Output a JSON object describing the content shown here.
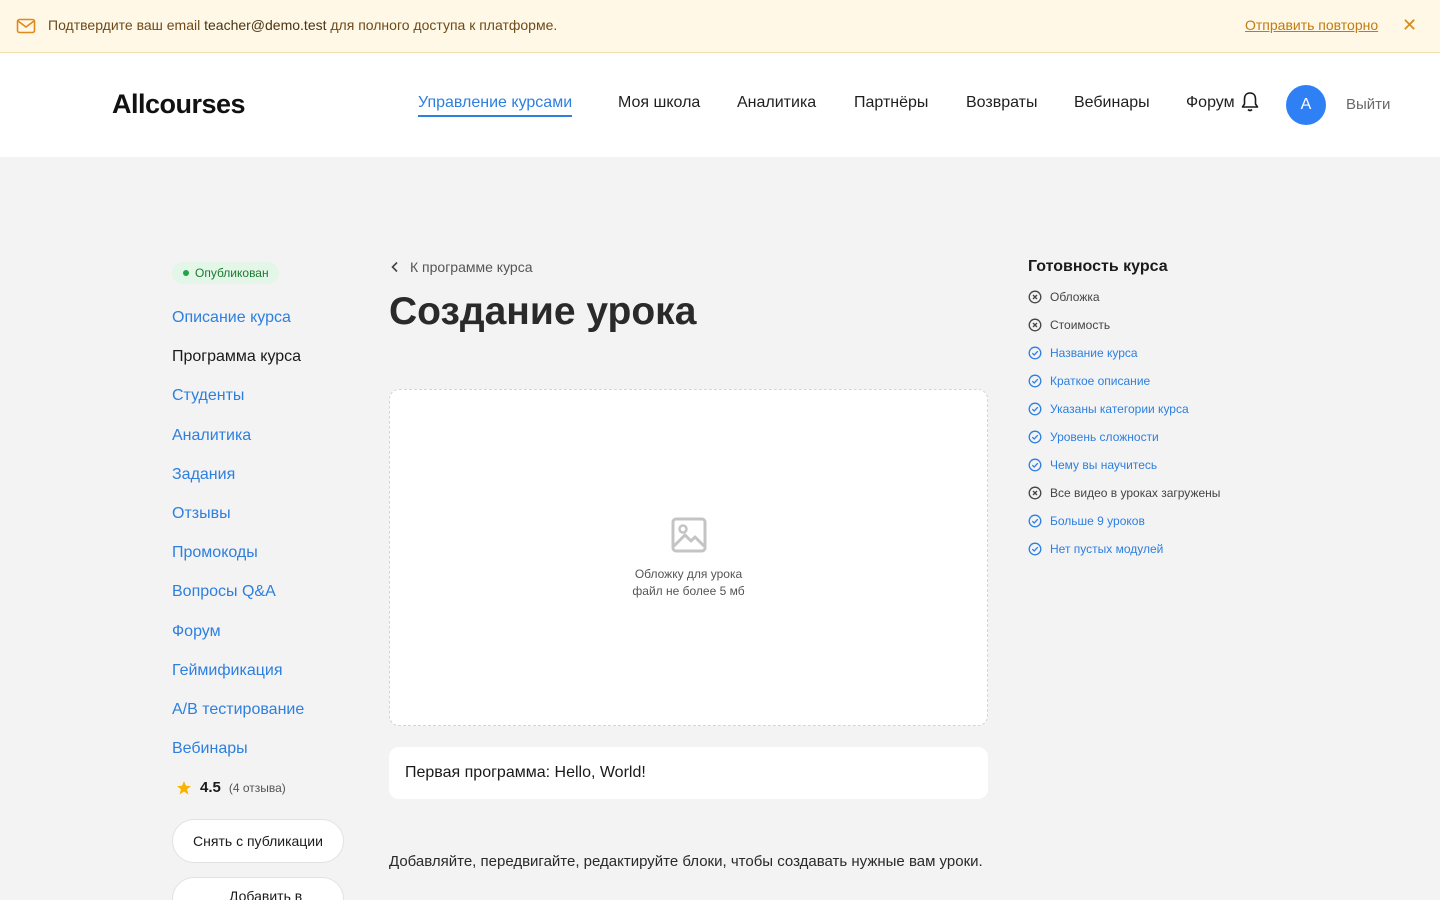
{
  "banner": {
    "prefix": "Подтвердите ваш email",
    "email": "teacher@demo.test",
    "suffix": "для полного доступа к платформе.",
    "resend_label": "Отправить повторно",
    "close_symbol": "✕"
  },
  "header": {
    "logo": "Allcourses",
    "nav": [
      {
        "label": "Управление курсами",
        "active": true
      },
      {
        "label": "Моя школа"
      },
      {
        "label": "Аналитика"
      },
      {
        "label": "Партнёры"
      },
      {
        "label": "Возвраты"
      },
      {
        "label": "Вебинары"
      },
      {
        "label": "Форум"
      }
    ],
    "avatar_letter": "A",
    "logout_label": "Выйти"
  },
  "sidebar": {
    "status_badge": "Опубликован",
    "items": [
      {
        "label": "Описание курса"
      },
      {
        "label": "Программа курса",
        "current": true
      },
      {
        "label": "Студенты"
      },
      {
        "label": "Аналитика"
      },
      {
        "label": "Задания"
      },
      {
        "label": "Отзывы"
      },
      {
        "label": "Промокоды"
      },
      {
        "label": "Вопросы Q&A"
      },
      {
        "label": "Форум"
      },
      {
        "label": "Геймификация"
      },
      {
        "label": "A/B тестирование"
      },
      {
        "label": "Вебинары"
      }
    ],
    "rating": {
      "value": "4.5",
      "count": "(4 отзыва)"
    },
    "unpublish_label": "Снять с публикации",
    "add_label": "Добавить в"
  },
  "main": {
    "back_label": "К программе курса",
    "title": "Создание урока",
    "upload": {
      "line1": "Обложку для урока",
      "line2": "файл не более 5 мб"
    },
    "lesson_name": "Первая программа: Hello, World!",
    "hint": "Добавляйте, передвигайте, редактируйте блоки, чтобы создавать нужные вам уроки."
  },
  "readiness": {
    "title": "Готовность курса",
    "items": [
      {
        "label": "Обложка",
        "done": false
      },
      {
        "label": "Стоимость",
        "done": false
      },
      {
        "label": "Название курса",
        "done": true
      },
      {
        "label": "Краткое описание",
        "done": true
      },
      {
        "label": "Указаны категории курса",
        "done": true
      },
      {
        "label": "Уровень сложности",
        "done": true
      },
      {
        "label": "Чему вы научитесь",
        "done": true
      },
      {
        "label": "Все видео в уроках загружены",
        "done": false
      },
      {
        "label": "Больше 9 уроков",
        "done": true
      },
      {
        "label": "Нет пустых модулей",
        "done": true
      }
    ]
  },
  "colors": {
    "accent": "#2d7fe0",
    "banner_bg": "#fff8e6",
    "published": "#1fa64a"
  }
}
